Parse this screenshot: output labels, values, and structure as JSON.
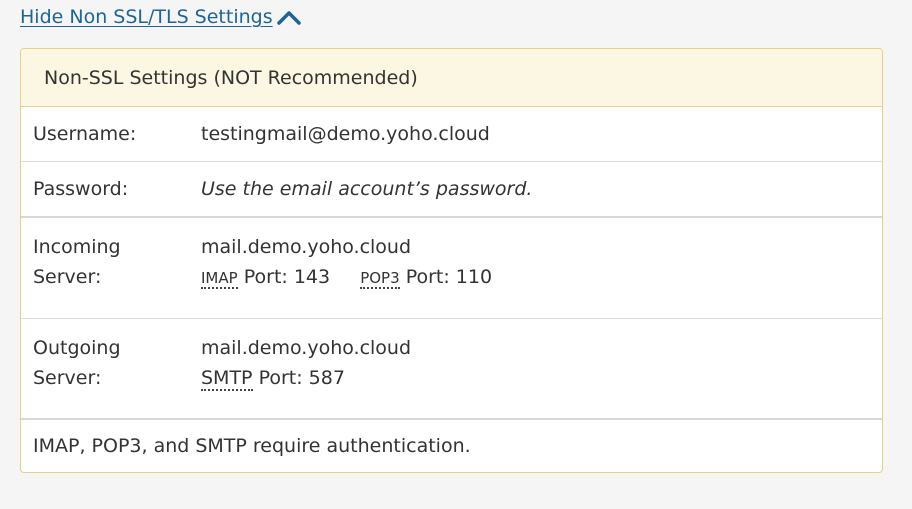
{
  "toggle": {
    "label": "Hide Non SSL/TLS Settings",
    "icon": "chevron-up-icon"
  },
  "panel": {
    "title": "Non-SSL Settings (NOT Recommended)",
    "username": {
      "label": "Username:",
      "value": "testingmail@demo.yoho.cloud"
    },
    "password": {
      "label": "Password:",
      "value": "Use the email account’s password."
    },
    "incoming": {
      "label_line1": "Incoming",
      "label_line2": "Server:",
      "host": "mail.demo.yoho.cloud",
      "imap_abbr": "IMAP",
      "imap_port_text": "Port: 143",
      "pop3_abbr": "POP3",
      "pop3_port_text": "Port: 110"
    },
    "outgoing": {
      "label_line1": "Outgoing",
      "label_line2": "Server:",
      "host": "mail.demo.yoho.cloud",
      "smtp_abbr": "SMTP",
      "smtp_port_text": "Port: 587"
    },
    "note": "IMAP, POP3, and SMTP require authentication."
  },
  "colors": {
    "link": "#1e6596",
    "panel_border": "#e6cf86",
    "panel_header_bg": "#fcf7e2"
  }
}
